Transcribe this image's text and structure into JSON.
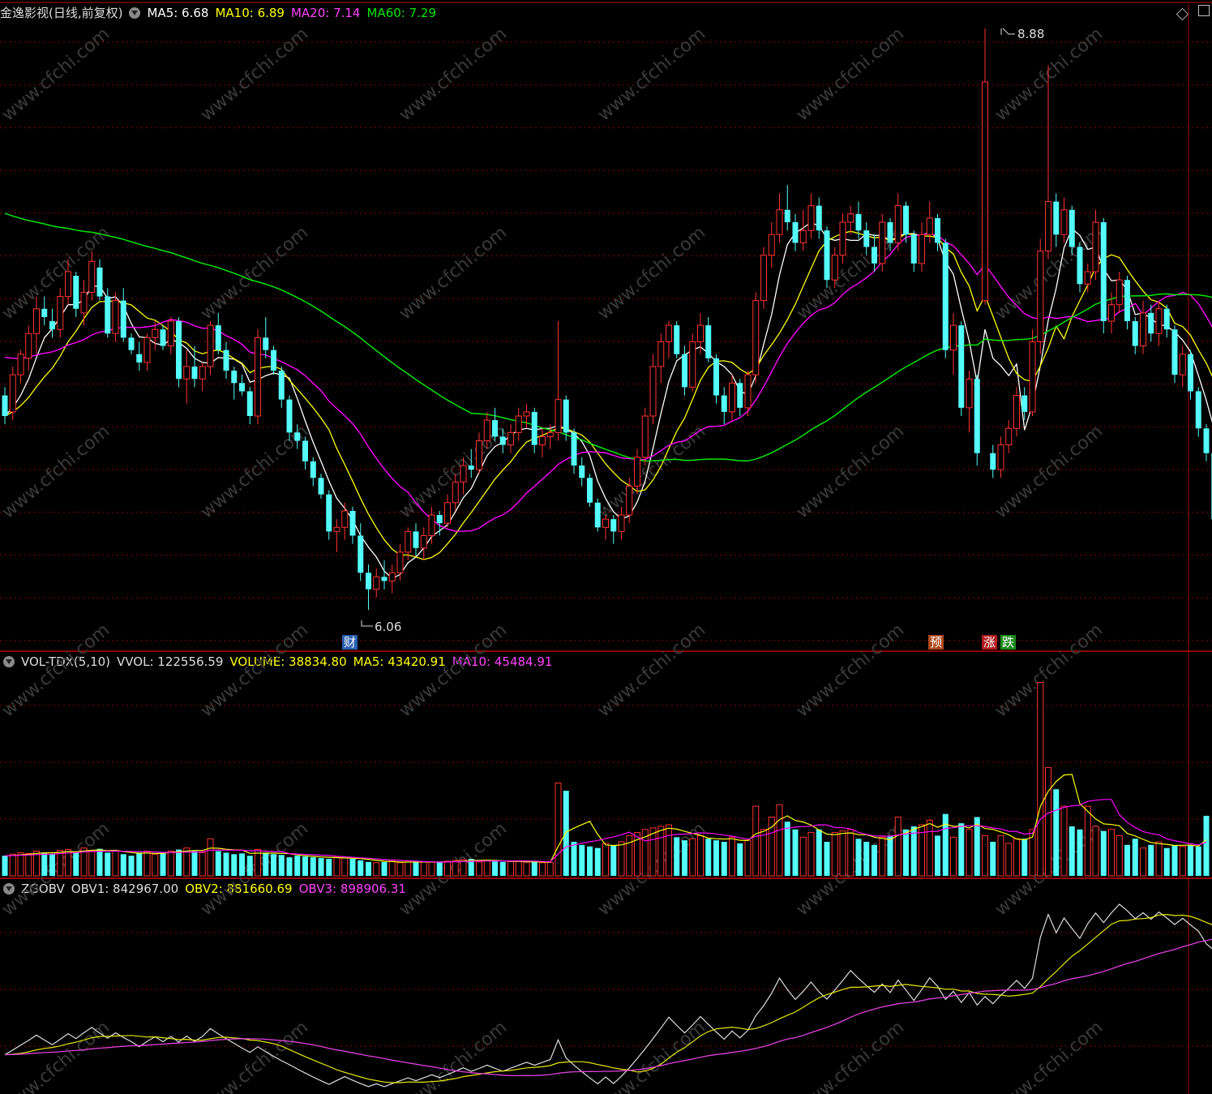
{
  "header": {
    "stock_name": "金逸影视(日线,前复权)",
    "ma5": "MA5: 6.68",
    "ma10": "MA10: 6.89",
    "ma20": "MA20: 7.14",
    "ma60": "MA60: 7.29"
  },
  "vol_header": {
    "name": "VOL-TDX(5,10)",
    "vvol": "VVOL: 122556.59",
    "volume": "VOLUME: 38834.80",
    "ma5": "MA5: 43420.91",
    "ma10": "MA10: 45484.91"
  },
  "obv_header": {
    "name": "ZGOBV",
    "obv1": "OBV1: 842967.00",
    "obv2": "OBV2: 881660.69",
    "obv3": "OBV3: 898906.31"
  },
  "annotations": {
    "high": "8.88",
    "low": "6.06",
    "marker_cai": "财",
    "marker_yu": "预",
    "marker_zhang": "涨",
    "marker_die": "跌"
  },
  "watermark": "www.cfchi.com",
  "colors": {
    "up": "#ff3232",
    "down": "#54fcfc",
    "ma5": "#ffffff",
    "ma10": "#ffff00",
    "ma20": "#ff00ff",
    "ma60": "#00e600",
    "grid": "#8b0000"
  },
  "chart_data": [
    {
      "type": "candlestick",
      "title": "金逸影视(日线,前复权)",
      "y_range": [
        6.0,
        9.0
      ],
      "annotated_high": 8.88,
      "annotated_low": 6.06,
      "ohlc": [
        [
          7.1,
          7.14,
          6.96,
          7.0
        ],
        [
          7.02,
          7.24,
          6.98,
          7.2
        ],
        [
          7.2,
          7.32,
          7.16,
          7.3
        ],
        [
          7.28,
          7.44,
          7.22,
          7.4
        ],
        [
          7.4,
          7.58,
          7.3,
          7.52
        ],
        [
          7.52,
          7.58,
          7.44,
          7.48
        ],
        [
          7.46,
          7.52,
          7.38,
          7.42
        ],
        [
          7.42,
          7.62,
          7.38,
          7.58
        ],
        [
          7.58,
          7.76,
          7.54,
          7.7
        ],
        [
          7.68,
          7.7,
          7.48,
          7.52
        ],
        [
          7.5,
          7.66,
          7.44,
          7.6
        ],
        [
          7.6,
          7.8,
          7.56,
          7.75
        ],
        [
          7.72,
          7.76,
          7.56,
          7.58
        ],
        [
          7.58,
          7.62,
          7.38,
          7.4
        ],
        [
          7.4,
          7.6,
          7.36,
          7.56
        ],
        [
          7.56,
          7.62,
          7.36,
          7.38
        ],
        [
          7.38,
          7.4,
          7.3,
          7.32
        ],
        [
          7.3,
          7.36,
          7.22,
          7.26
        ],
        [
          7.26,
          7.4,
          7.22,
          7.38
        ],
        [
          7.38,
          7.46,
          7.32,
          7.42
        ],
        [
          7.42,
          7.44,
          7.32,
          7.34
        ],
        [
          7.34,
          7.48,
          7.3,
          7.46
        ],
        [
          7.46,
          7.48,
          7.14,
          7.18
        ],
        [
          7.18,
          7.32,
          7.06,
          7.24
        ],
        [
          7.24,
          7.34,
          7.14,
          7.18
        ],
        [
          7.18,
          7.26,
          7.12,
          7.24
        ],
        [
          7.24,
          7.46,
          7.2,
          7.44
        ],
        [
          7.44,
          7.5,
          7.3,
          7.32
        ],
        [
          7.32,
          7.36,
          7.18,
          7.22
        ],
        [
          7.22,
          7.24,
          7.08,
          7.16
        ],
        [
          7.16,
          7.2,
          7.1,
          7.12
        ],
        [
          7.12,
          7.14,
          6.96,
          7.0
        ],
        [
          7.0,
          7.42,
          6.96,
          7.38
        ],
        [
          7.38,
          7.48,
          7.28,
          7.32
        ],
        [
          7.32,
          7.34,
          7.2,
          7.22
        ],
        [
          7.22,
          7.24,
          7.04,
          7.08
        ],
        [
          7.08,
          7.1,
          6.88,
          6.92
        ],
        [
          6.92,
          6.96,
          6.84,
          6.88
        ],
        [
          6.88,
          6.9,
          6.74,
          6.78
        ],
        [
          6.78,
          6.8,
          6.66,
          6.7
        ],
        [
          6.7,
          6.72,
          6.6,
          6.62
        ],
        [
          6.62,
          6.64,
          6.4,
          6.44
        ],
        [
          6.44,
          6.5,
          6.34,
          6.46
        ],
        [
          6.46,
          6.58,
          6.4,
          6.54
        ],
        [
          6.54,
          6.56,
          6.38,
          6.42
        ],
        [
          6.42,
          6.48,
          6.2,
          6.24
        ],
        [
          6.24,
          6.28,
          6.06,
          6.16
        ],
        [
          6.16,
          6.26,
          6.12,
          6.22
        ],
        [
          6.22,
          6.3,
          6.16,
          6.2
        ],
        [
          6.2,
          6.28,
          6.14,
          6.24
        ],
        [
          6.24,
          6.38,
          6.2,
          6.34
        ],
        [
          6.34,
          6.46,
          6.3,
          6.44
        ],
        [
          6.44,
          6.48,
          6.32,
          6.36
        ],
        [
          6.36,
          6.46,
          6.3,
          6.42
        ],
        [
          6.42,
          6.56,
          6.38,
          6.52
        ],
        [
          6.52,
          6.54,
          6.42,
          6.48
        ],
        [
          6.48,
          6.62,
          6.46,
          6.58
        ],
        [
          6.58,
          6.72,
          6.54,
          6.68
        ],
        [
          6.68,
          6.8,
          6.62,
          6.76
        ],
        [
          6.76,
          6.84,
          6.7,
          6.74
        ],
        [
          6.74,
          6.92,
          6.72,
          6.88
        ],
        [
          6.88,
          7.02,
          6.84,
          6.98
        ],
        [
          6.98,
          7.04,
          6.88,
          6.9
        ],
        [
          6.9,
          6.94,
          6.82,
          6.86
        ],
        [
          6.86,
          6.96,
          6.82,
          6.92
        ],
        [
          6.92,
          7.04,
          6.88,
          7.0
        ],
        [
          7.0,
          7.06,
          6.94,
          7.02
        ],
        [
          7.02,
          7.04,
          6.82,
          6.86
        ],
        [
          6.86,
          6.94,
          6.8,
          6.9
        ],
        [
          6.9,
          6.96,
          6.84,
          6.92
        ],
        [
          6.92,
          7.46,
          6.88,
          7.08
        ],
        [
          7.08,
          7.1,
          6.88,
          6.92
        ],
        [
          6.92,
          6.94,
          6.72,
          6.76
        ],
        [
          6.76,
          6.8,
          6.66,
          6.7
        ],
        [
          6.7,
          6.72,
          6.56,
          6.58
        ],
        [
          6.58,
          6.6,
          6.44,
          6.46
        ],
        [
          6.46,
          6.52,
          6.4,
          6.5
        ],
        [
          6.5,
          6.52,
          6.38,
          6.44
        ],
        [
          6.44,
          6.56,
          6.4,
          6.52
        ],
        [
          6.52,
          6.7,
          6.48,
          6.66
        ],
        [
          6.66,
          6.84,
          6.62,
          6.8
        ],
        [
          6.8,
          7.04,
          6.76,
          7.0
        ],
        [
          7.0,
          7.3,
          6.96,
          7.24
        ],
        [
          7.24,
          7.4,
          7.16,
          7.36
        ],
        [
          7.36,
          7.46,
          7.28,
          7.44
        ],
        [
          7.44,
          7.46,
          7.28,
          7.3
        ],
        [
          7.3,
          7.34,
          7.1,
          7.14
        ],
        [
          7.14,
          7.4,
          7.12,
          7.36
        ],
        [
          7.36,
          7.5,
          7.3,
          7.44
        ],
        [
          7.44,
          7.48,
          7.26,
          7.28
        ],
        [
          7.28,
          7.3,
          7.06,
          7.1
        ],
        [
          7.1,
          7.14,
          6.96,
          7.02
        ],
        [
          7.02,
          7.2,
          6.98,
          7.16
        ],
        [
          7.16,
          7.18,
          7.0,
          7.04
        ],
        [
          7.04,
          7.22,
          7.0,
          7.2
        ],
        [
          7.2,
          7.6,
          7.16,
          7.56
        ],
        [
          7.56,
          7.82,
          7.52,
          7.78
        ],
        [
          7.78,
          7.94,
          7.72,
          7.88
        ],
        [
          7.88,
          8.08,
          7.84,
          8.0
        ],
        [
          8.0,
          8.12,
          7.9,
          7.94
        ],
        [
          7.94,
          7.98,
          7.8,
          7.84
        ],
        [
          7.84,
          8.0,
          7.8,
          7.9
        ],
        [
          7.9,
          8.08,
          7.86,
          8.02
        ],
        [
          8.02,
          8.06,
          7.86,
          7.9
        ],
        [
          7.9,
          7.92,
          7.62,
          7.66
        ],
        [
          7.66,
          7.82,
          7.62,
          7.78
        ],
        [
          7.78,
          7.98,
          7.74,
          7.94
        ],
        [
          7.94,
          8.02,
          7.88,
          7.98
        ],
        [
          7.98,
          8.04,
          7.86,
          7.9
        ],
        [
          7.9,
          7.94,
          7.78,
          7.82
        ],
        [
          7.82,
          7.88,
          7.7,
          7.74
        ],
        [
          7.74,
          7.98,
          7.7,
          7.94
        ],
        [
          7.94,
          7.96,
          7.8,
          7.84
        ],
        [
          7.84,
          8.08,
          7.8,
          8.02
        ],
        [
          8.02,
          8.04,
          7.84,
          7.88
        ],
        [
          7.88,
          7.9,
          7.7,
          7.74
        ],
        [
          7.74,
          7.94,
          7.7,
          7.88
        ],
        [
          7.88,
          8.04,
          7.84,
          7.96
        ],
        [
          7.96,
          7.98,
          7.8,
          7.84
        ],
        [
          7.84,
          7.86,
          7.28,
          7.32
        ],
        [
          7.32,
          7.5,
          7.2,
          7.44
        ],
        [
          7.44,
          7.46,
          7.0,
          7.04
        ],
        [
          7.04,
          7.22,
          6.92,
          7.18
        ],
        [
          7.18,
          7.2,
          6.76,
          6.82
        ],
        [
          6.82,
          6.86,
          6.7,
          6.74
        ],
        [
          6.74,
          6.9,
          6.7,
          6.86
        ],
        [
          6.86,
          6.98,
          6.82,
          6.94
        ],
        [
          6.94,
          7.14,
          6.9,
          7.1
        ],
        [
          7.1,
          7.14,
          6.98,
          7.02
        ],
        [
          7.02,
          7.42,
          7.0,
          7.36
        ],
        [
          7.36,
          7.86,
          7.3,
          7.8
        ],
        [
          7.8,
          8.7,
          7.76,
          8.04
        ],
        [
          8.04,
          8.08,
          7.82,
          7.88
        ],
        [
          7.88,
          8.06,
          7.84,
          8.0
        ],
        [
          8.0,
          8.02,
          7.78,
          7.82
        ],
        [
          7.82,
          7.84,
          7.6,
          7.64
        ],
        [
          7.64,
          7.74,
          7.6,
          7.7
        ],
        [
          7.7,
          8.0,
          7.66,
          7.94
        ],
        [
          7.94,
          7.96,
          7.4,
          7.46
        ],
        [
          7.46,
          7.6,
          7.4,
          7.54
        ],
        [
          7.54,
          7.7,
          7.5,
          7.66
        ],
        [
          7.66,
          7.68,
          7.42,
          7.46
        ],
        [
          7.46,
          7.48,
          7.3,
          7.34
        ],
        [
          7.34,
          7.56,
          7.3,
          7.5
        ],
        [
          7.5,
          7.54,
          7.36,
          7.4
        ],
        [
          7.4,
          7.56,
          7.34,
          7.52
        ],
        [
          7.52,
          7.54,
          7.38,
          7.42
        ],
        [
          7.42,
          7.44,
          7.16,
          7.2
        ],
        [
          7.2,
          7.34,
          7.14,
          7.3
        ],
        [
          7.3,
          7.32,
          7.08,
          7.12
        ],
        [
          7.12,
          7.14,
          6.9,
          6.94
        ],
        [
          6.94,
          6.96,
          6.78,
          6.82
        ],
        [
          6.82,
          6.84,
          6.46,
          6.5
        ],
        [
          6.5,
          6.62,
          6.46,
          6.58
        ],
        [
          6.58,
          6.7,
          6.52,
          6.66
        ]
      ],
      "special_candle": {
        "index": 124,
        "open": 7.56,
        "high": 8.88,
        "low": 7.54,
        "close": 8.62
      },
      "series": [
        {
          "name": "MA5",
          "color": "#ffffff"
        },
        {
          "name": "MA10",
          "color": "#ffff00"
        },
        {
          "name": "MA20",
          "color": "#ff00ff"
        },
        {
          "name": "MA60",
          "color": "#00e600"
        }
      ]
    },
    {
      "type": "bar",
      "title": "VOL-TDX(5,10)",
      "y_range": [
        0,
        130000
      ],
      "volume": [
        13000,
        14000,
        15000,
        14500,
        16000,
        15000,
        14000,
        16500,
        17000,
        15000,
        18000,
        16000,
        17500,
        15000,
        16000,
        14000,
        13000,
        15000,
        16000,
        14000,
        15000,
        16000,
        17000,
        18000,
        16000,
        15000,
        24000,
        16000,
        15000,
        14000,
        14500,
        13000,
        17000,
        15000,
        14000,
        13500,
        12000,
        13000,
        12500,
        12000,
        11500,
        11000,
        12000,
        11500,
        11000,
        10000,
        9000,
        8500,
        9000,
        9500,
        8500,
        9000,
        8800,
        9200,
        9000,
        8800,
        9500,
        10000,
        10500,
        11000,
        9000,
        10000,
        9500,
        9000,
        9200,
        9300,
        8800,
        9000,
        8500,
        8700,
        60000,
        55000,
        22000,
        20000,
        19000,
        18000,
        21000,
        20000,
        22000,
        26000,
        28000,
        30000,
        31000,
        32000,
        33000,
        25000,
        23000,
        24000,
        26000,
        24000,
        23000,
        22000,
        25000,
        21000,
        23000,
        45000,
        30000,
        38000,
        46000,
        35000,
        30000,
        25000,
        28000,
        30000,
        22000,
        28000,
        29000,
        30000,
        24000,
        22000,
        20000,
        25000,
        26000,
        38000,
        30000,
        32000,
        33000,
        36000,
        26000,
        40000,
        25000,
        34000,
        30000,
        38000,
        26000,
        22000,
        26000,
        21000,
        24000,
        24000,
        30000,
        125000,
        70000,
        56000,
        45000,
        32000,
        30000,
        45000,
        32000,
        29000,
        30000,
        26000,
        20000,
        24000,
        18000,
        20000,
        22000,
        18000,
        20000,
        19000,
        20000,
        19000,
        38834
      ]
    },
    {
      "type": "line",
      "title": "ZGOBV",
      "series": [
        {
          "name": "OBV1",
          "color": "#dddddd"
        },
        {
          "name": "OBV2",
          "color": "#e8e800"
        },
        {
          "name": "OBV3",
          "color": "#e040e0"
        }
      ]
    }
  ]
}
